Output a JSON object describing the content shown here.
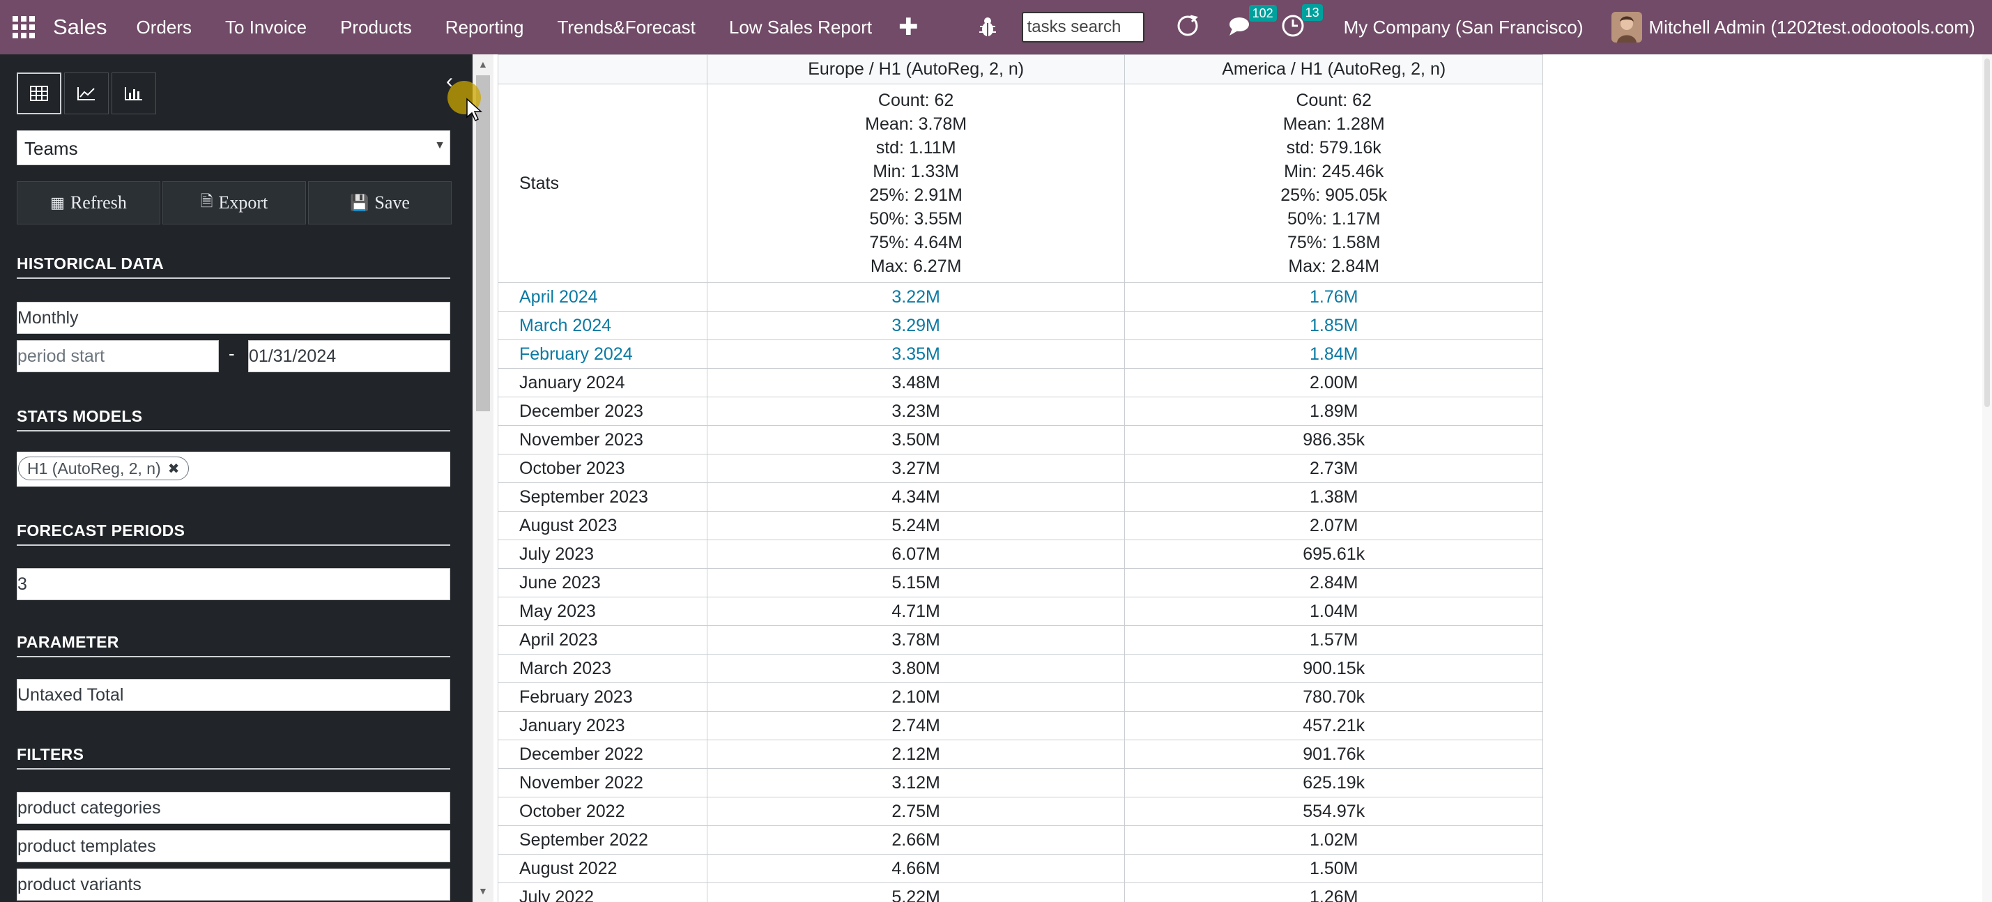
{
  "navbar": {
    "brand": "Sales",
    "menu": [
      "Orders",
      "To Invoice",
      "Products",
      "Reporting",
      "Trends&Forecast",
      "Low Sales Report"
    ],
    "search_value": "tasks search",
    "messages_count": "102",
    "activities_count": "13",
    "company": "My Company (San Francisco)",
    "user": "Mitchell Admin (1202test.odootools.com)"
  },
  "sidebar": {
    "group_by": "Teams",
    "buttons": {
      "refresh": "Refresh",
      "export": "Export",
      "save": "Save"
    },
    "historical_title": "HISTORICAL DATA",
    "interval": "Monthly",
    "period_start_placeholder": "period start",
    "period_end": "01/31/2024",
    "stats_models_title": "STATS MODELS",
    "model_tag": "H1 (AutoReg, 2, n)",
    "forecast_title": "FORECAST PERIODS",
    "forecast_periods": "3",
    "parameter_title": "PARAMETER",
    "parameter_value": "Untaxed Total",
    "filters_title": "FILTERS",
    "filters": [
      "product categories",
      "product templates",
      "product variants"
    ]
  },
  "table": {
    "headers": [
      "",
      "Europe / H1 (AutoReg, 2, n)",
      "America / H1 (AutoReg, 2, n)"
    ],
    "stats_label": "Stats",
    "stats": {
      "europe": [
        "Count: 62",
        "Mean: 3.78M",
        "std: 1.11M",
        "Min: 1.33M",
        "25%: 2.91M",
        "50%: 3.55M",
        "75%: 4.64M",
        "Max: 6.27M"
      ],
      "america": [
        "Count: 62",
        "Mean: 1.28M",
        "std: 579.16k",
        "Min: 245.46k",
        "25%: 905.05k",
        "50%: 1.17M",
        "75%: 1.58M",
        "Max: 2.84M"
      ]
    },
    "rows": [
      {
        "period": "April 2024",
        "europe": "3.22M",
        "america": "1.76M",
        "forecast": true
      },
      {
        "period": "March 2024",
        "europe": "3.29M",
        "america": "1.85M",
        "forecast": true
      },
      {
        "period": "February 2024",
        "europe": "3.35M",
        "america": "1.84M",
        "forecast": true
      },
      {
        "period": "January 2024",
        "europe": "3.48M",
        "america": "2.00M",
        "forecast": false
      },
      {
        "period": "December 2023",
        "europe": "3.23M",
        "america": "1.89M",
        "forecast": false
      },
      {
        "period": "November 2023",
        "europe": "3.50M",
        "america": "986.35k",
        "forecast": false
      },
      {
        "period": "October 2023",
        "europe": "3.27M",
        "america": "2.73M",
        "forecast": false
      },
      {
        "period": "September 2023",
        "europe": "4.34M",
        "america": "1.38M",
        "forecast": false
      },
      {
        "period": "August 2023",
        "europe": "5.24M",
        "america": "2.07M",
        "forecast": false
      },
      {
        "period": "July 2023",
        "europe": "6.07M",
        "america": "695.61k",
        "forecast": false
      },
      {
        "period": "June 2023",
        "europe": "5.15M",
        "america": "2.84M",
        "forecast": false
      },
      {
        "period": "May 2023",
        "europe": "4.71M",
        "america": "1.04M",
        "forecast": false
      },
      {
        "period": "April 2023",
        "europe": "3.78M",
        "america": "1.57M",
        "forecast": false
      },
      {
        "period": "March 2023",
        "europe": "3.80M",
        "america": "900.15k",
        "forecast": false
      },
      {
        "period": "February 2023",
        "europe": "2.10M",
        "america": "780.70k",
        "forecast": false
      },
      {
        "period": "January 2023",
        "europe": "2.74M",
        "america": "457.21k",
        "forecast": false
      },
      {
        "period": "December 2022",
        "europe": "2.12M",
        "america": "901.76k",
        "forecast": false
      },
      {
        "period": "November 2022",
        "europe": "3.12M",
        "america": "625.19k",
        "forecast": false
      },
      {
        "period": "October 2022",
        "europe": "2.75M",
        "america": "554.97k",
        "forecast": false
      },
      {
        "period": "September 2022",
        "europe": "2.66M",
        "america": "1.02M",
        "forecast": false
      },
      {
        "period": "August 2022",
        "europe": "4.66M",
        "america": "1.50M",
        "forecast": false
      },
      {
        "period": "July 2022",
        "europe": "5.22M",
        "america": "1.26M",
        "forecast": false
      }
    ]
  }
}
